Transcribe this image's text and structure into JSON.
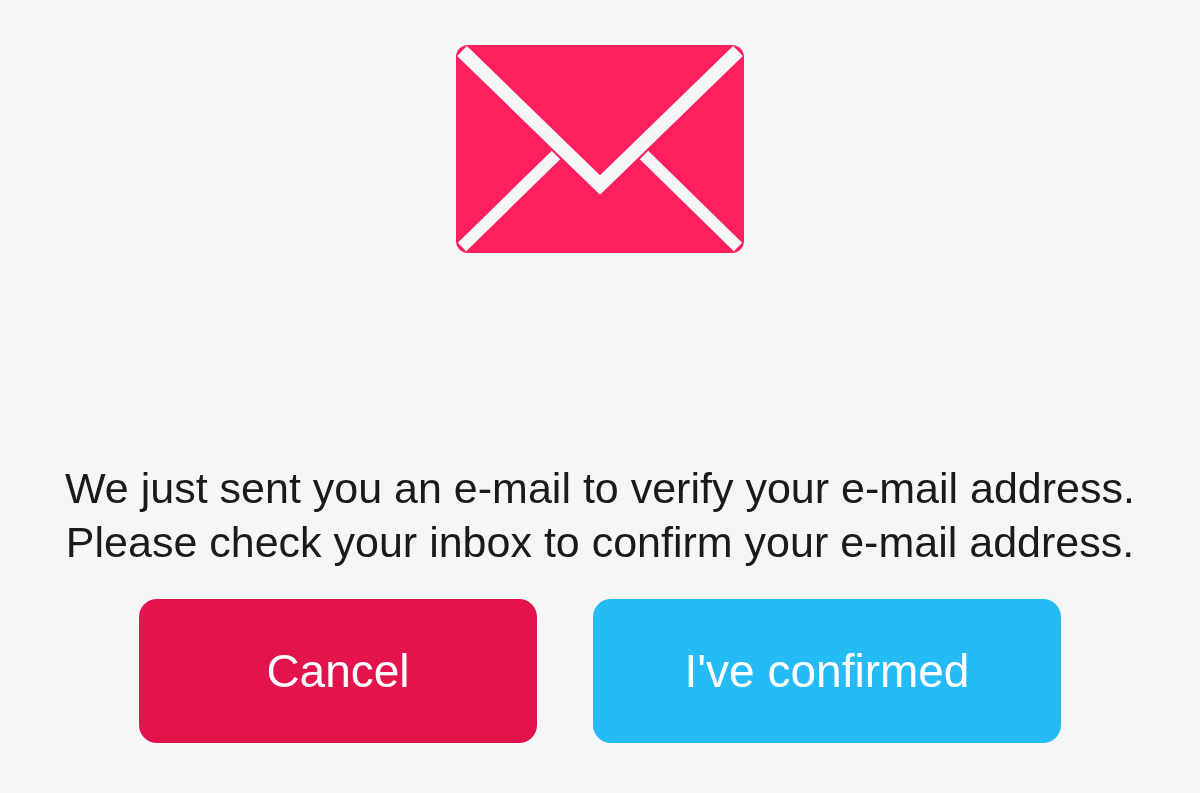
{
  "message": "We just sent you an e-mail to verify your e-mail address. Please check your inbox to confirm your e-mail address.",
  "buttons": [
    {
      "label": "Cancel",
      "kind": "cancel"
    },
    {
      "label": "I've confirmed",
      "kind": "confirm"
    }
  ]
}
